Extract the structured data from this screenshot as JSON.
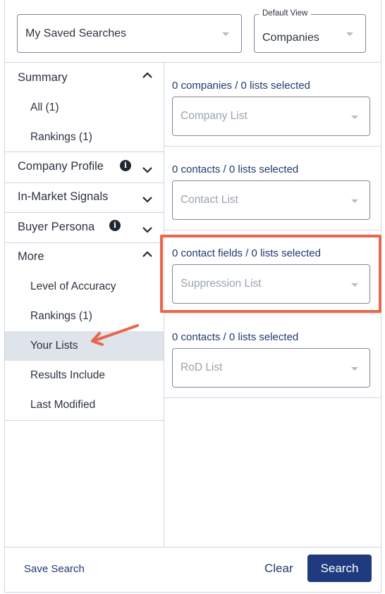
{
  "top": {
    "saved_searches": "My Saved Searches",
    "default_view_label": "Default View",
    "default_view_value": "Companies"
  },
  "nav": {
    "summary": "Summary",
    "summary_items": [
      "All (1)",
      "Rankings (1)"
    ],
    "company_profile": "Company Profile",
    "in_market_signals": "In-Market Signals",
    "buyer_persona": "Buyer Persona",
    "more": "More",
    "more_items": [
      "Level of Accuracy",
      "Rankings (1)",
      "Your Lists",
      "Results Include",
      "Last Modified"
    ],
    "active_item": "Your Lists",
    "info_glyph": "i"
  },
  "lists": [
    {
      "count": "0 companies / 0 lists selected",
      "placeholder": "Company List"
    },
    {
      "count": "0 contacts / 0 lists selected",
      "placeholder": "Contact List"
    },
    {
      "count": "0 contact fields / 0 lists selected",
      "placeholder": "Suppression List"
    },
    {
      "count": "0 contacts / 0 lists selected",
      "placeholder": "RoD List"
    }
  ],
  "footer": {
    "save_search": "Save Search",
    "clear": "Clear",
    "search": "Search"
  },
  "colors": {
    "accent_navy": "#1f3a7e",
    "highlight": "#e8664b",
    "active_bg": "#dfe3ea"
  }
}
